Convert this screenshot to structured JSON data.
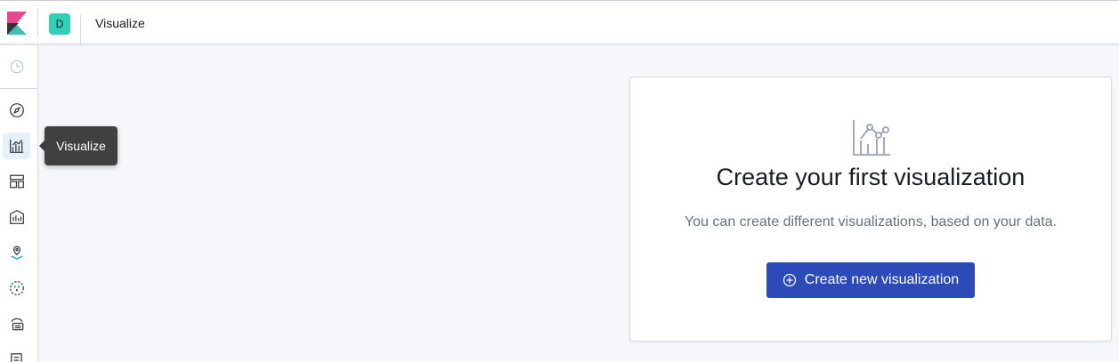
{
  "header": {
    "space_initial": "D",
    "breadcrumb": "Visualize",
    "logo_icon": "kibana-logo-icon"
  },
  "sidebar": {
    "items": [
      {
        "icon": "recently-viewed-clock-icon"
      },
      {
        "icon": "discover-compass-icon"
      },
      {
        "icon": "visualize-chart-icon",
        "active": true
      },
      {
        "icon": "dashboard-icon"
      },
      {
        "icon": "canvas-icon"
      },
      {
        "icon": "maps-icon"
      },
      {
        "icon": "machine-learning-icon"
      },
      {
        "icon": "infrastructure-icon"
      },
      {
        "icon": "logs-icon"
      }
    ]
  },
  "tooltip": {
    "label": "Visualize"
  },
  "empty_prompt": {
    "icon": "visualize-chart-icon",
    "title": "Create your first visualization",
    "description": "You can create different visualizations, based on your data.",
    "button_label": "Create new visualization",
    "button_icon": "plus-in-circle-icon"
  },
  "colors": {
    "accent": "#2c4bb8",
    "space_badge": "#2fd1b6",
    "active_nav_bg": "#e6f0f8",
    "tooltip_bg": "#404040"
  }
}
